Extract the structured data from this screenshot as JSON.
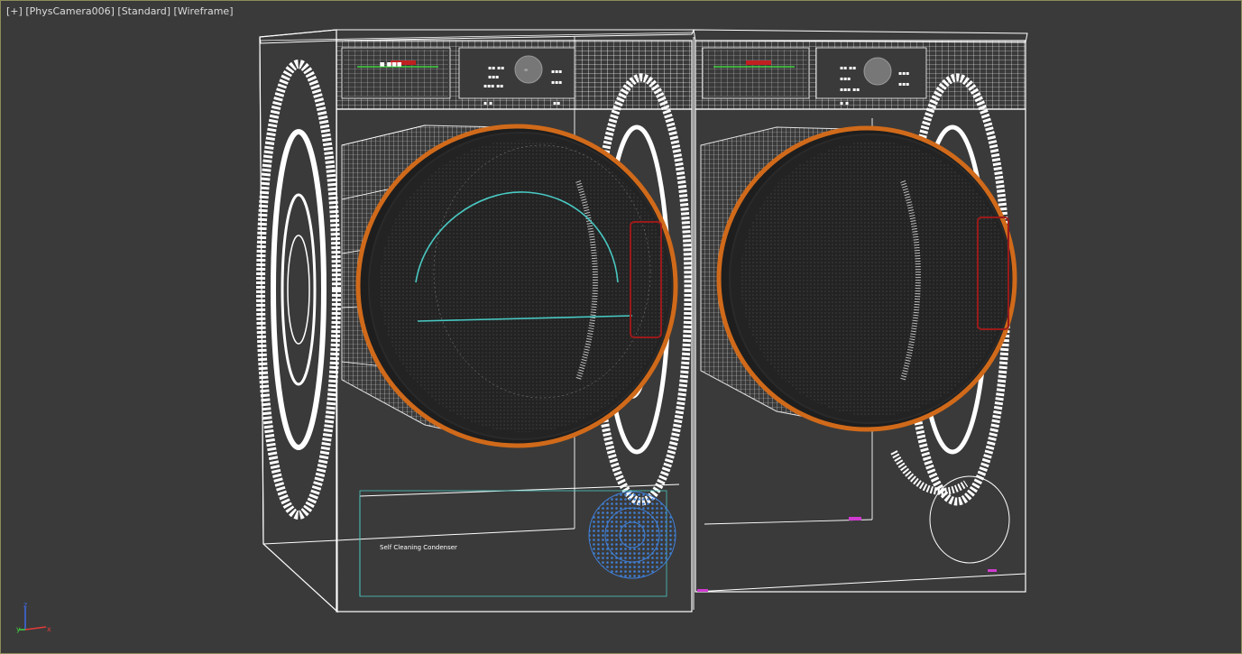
{
  "viewport": {
    "menu_label": "[+]",
    "camera_label": "[PhysCamera006]",
    "shading_label": "[Standard]",
    "display_label": "[Wireframe]"
  },
  "scene": {
    "condenser_label": "Self Cleaning Condenser"
  },
  "gizmo": {
    "z_label": "z",
    "y_label": "y",
    "x_label": "x",
    "z_color": "#3d6be8",
    "y_color": "#3fd33f",
    "x_color": "#e03b3b"
  },
  "colors": {
    "background": "#3a3a3a",
    "wire": "#ffffff",
    "door_rim": "#d06a1a",
    "selection": "#49c9c3",
    "filter": "#3f7fd6",
    "handle": "#9a1a1a",
    "marker": "#d03ad0"
  }
}
